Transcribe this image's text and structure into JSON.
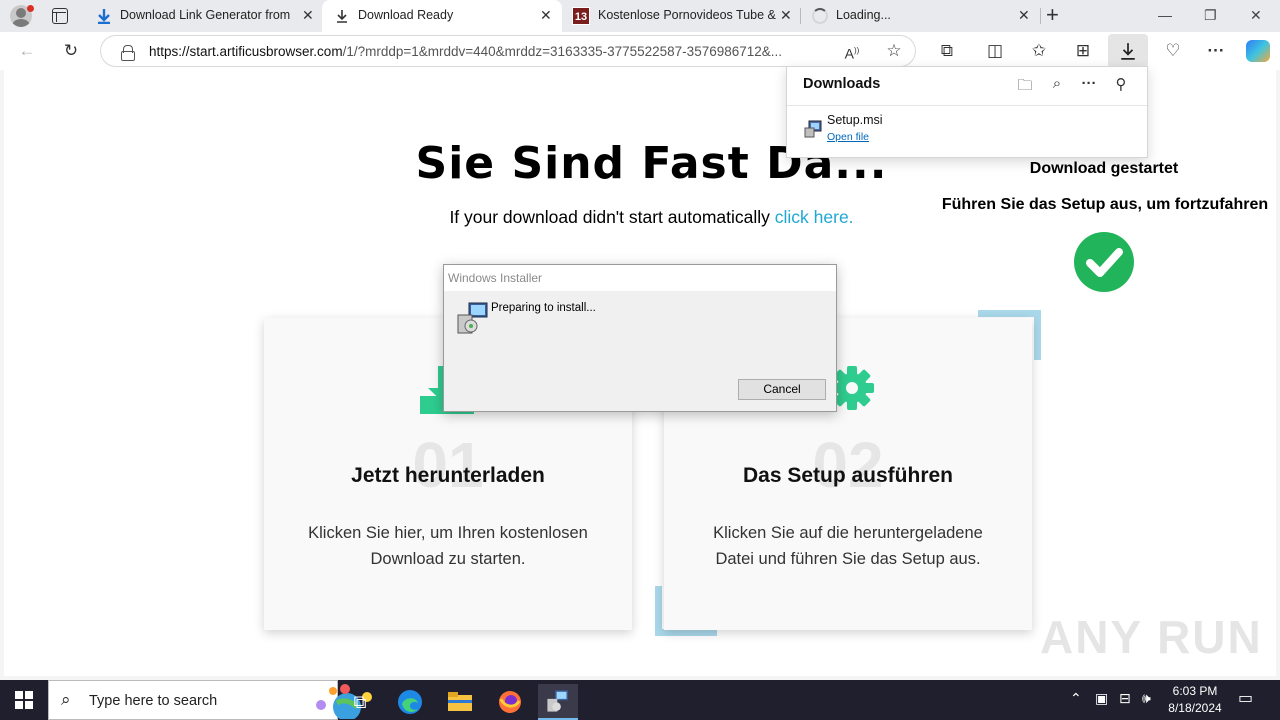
{
  "tabs": [
    {
      "title": "Download Link Generator from F",
      "icon": "download-arrow-icon"
    },
    {
      "title": "Download Ready",
      "icon": "download-arrow-icon"
    },
    {
      "title": "Kostenlose Pornovideos Tube & F",
      "icon": "site-13-icon",
      "favicon_text": "13"
    },
    {
      "title": "Loading...",
      "icon": "loading-spinner-icon"
    }
  ],
  "address": {
    "host": "https://start.artificusbrowser.com",
    "rest": "/1/?mrddp=1&mrddv=440&mrddz=3163335-3775522587-3576986712&..."
  },
  "downloads": {
    "title": "Downloads",
    "file_name": "Setup.msi",
    "open_label": "Open file"
  },
  "page": {
    "headline": "Sie Sind Fast Da...",
    "subline": "If your download didn't start automatically",
    "subline_link": "click here.",
    "right_title": "Download gestartet",
    "right_subtitle": "Führen Sie das Setup aus, um fortzufahren",
    "cards": [
      {
        "number": "01",
        "title": "Jetzt herunterladen",
        "text": "Klicken Sie hier, um Ihren kostenlosen Download zu starten."
      },
      {
        "number": "02",
        "title": "Das Setup ausführen",
        "text": "Klicken Sie auf die heruntergeladene Datei und führen Sie das Setup aus."
      }
    ],
    "watermark": "ANY RUN"
  },
  "installer": {
    "title": "Windows Installer",
    "message": "Preparing to install...",
    "cancel_label": "Cancel"
  },
  "taskbar": {
    "search_placeholder": "Type here to search",
    "time": "6:03 PM",
    "date": "8/18/2024"
  },
  "colors": {
    "accent_green": "#2ecc8f",
    "check_green": "#22b45a",
    "link_blue": "#1fa8d4",
    "card_accent": "#a9d8ea"
  }
}
